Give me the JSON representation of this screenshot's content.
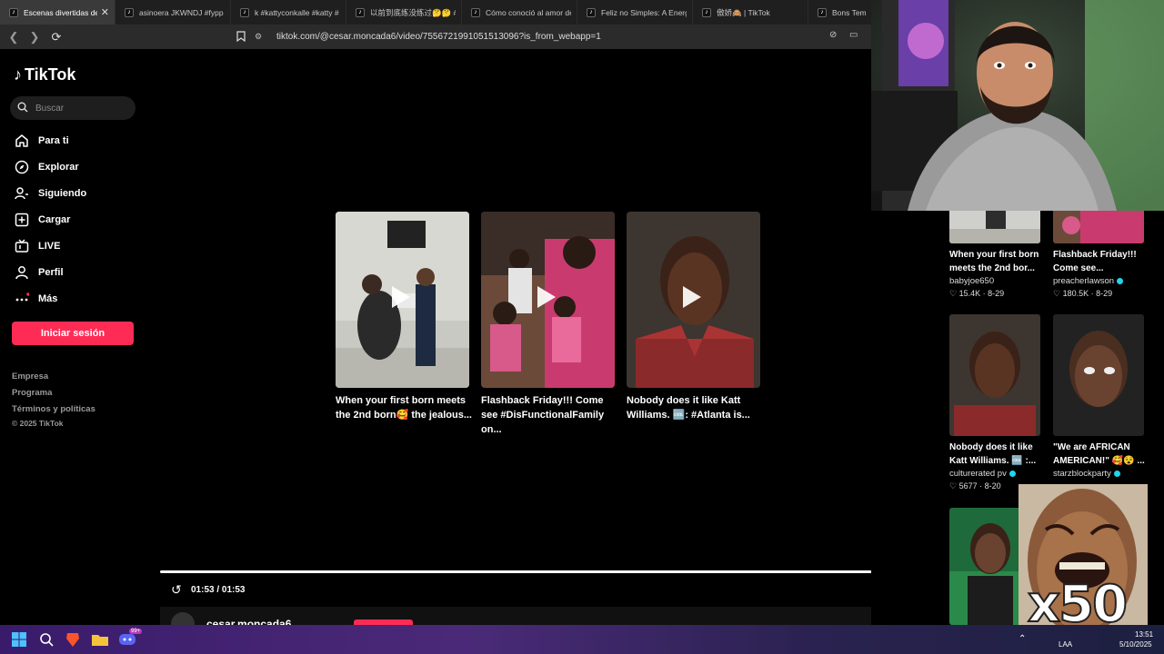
{
  "browser": {
    "tabs": [
      {
        "title": "Escenas divertidas de",
        "active": true
      },
      {
        "title": "asinoera JKWNDJ #fypp #",
        "active": false
      },
      {
        "title": "k #kattyconkalle #katty #",
        "active": false
      },
      {
        "title": "以前到底练没练过🤔🤔 #",
        "active": false
      },
      {
        "title": "Cómo conoció al amor de",
        "active": false
      },
      {
        "title": "Feliz no Simples: A Energi",
        "active": false
      },
      {
        "title": "傲娇🙈 | TikTok",
        "active": false
      },
      {
        "title": "Bons Tempos",
        "active": false
      }
    ],
    "url": "tiktok.com/@cesar.moncada6/video/7556721991051513096?is_from_webapp=1"
  },
  "sidebar": {
    "logo": "TikTok",
    "search_placeholder": "Buscar",
    "nav": [
      {
        "label": "Para ti",
        "icon": "home-icon"
      },
      {
        "label": "Explorar",
        "icon": "compass-icon"
      },
      {
        "label": "Siguiendo",
        "icon": "following-icon"
      },
      {
        "label": "Cargar",
        "icon": "upload-icon"
      },
      {
        "label": "LIVE",
        "icon": "live-icon"
      },
      {
        "label": "Perfil",
        "icon": "profile-icon"
      },
      {
        "label": "Más",
        "icon": "more-icon"
      }
    ],
    "login_label": "Iniciar sesión",
    "footer": [
      "Empresa",
      "Programa",
      "Términos y políticas"
    ],
    "copyright": "© 2025 TikTok"
  },
  "player": {
    "recommendations": [
      {
        "title": "When your first born meets the 2nd born🥰 the jealous..."
      },
      {
        "title": "Flashback Friday!!! Come see #DisFunctionalFamily on..."
      },
      {
        "title": "Nobody does it like Katt Williams. 🆒: #Atlanta is..."
      }
    ],
    "time": "01:53 / 01:53",
    "progress": 1.0,
    "author": "cesar.moncada6"
  },
  "related": [
    {
      "title": "When your first born meets the 2nd bor...",
      "author": "babyjoe650",
      "verified": false,
      "likes": "15.4K",
      "date": "8-29"
    },
    {
      "title": "Flashback Friday!!! Come see...",
      "author": "preacherlawson",
      "verified": true,
      "likes": "180.5K",
      "date": "8-29"
    },
    {
      "title": "Nobody does it like Katt Williams. 🆒 :...",
      "author": "culturerated pv",
      "verified": true,
      "likes": "5677",
      "date": "8-20"
    },
    {
      "title": "\"We are AFRICAN AMERICAN!\" 🥰😵 ...",
      "author": "starzblockparty",
      "verified": true,
      "likes": "",
      "date": ""
    }
  ],
  "overlay": {
    "meme_text": "x50"
  },
  "taskbar": {
    "badge": "99+",
    "lang": "LAA",
    "time": "13:51",
    "date": "5/10/2025"
  },
  "colors": {
    "accent": "#fe2c55",
    "verified": "#20d5ec"
  }
}
